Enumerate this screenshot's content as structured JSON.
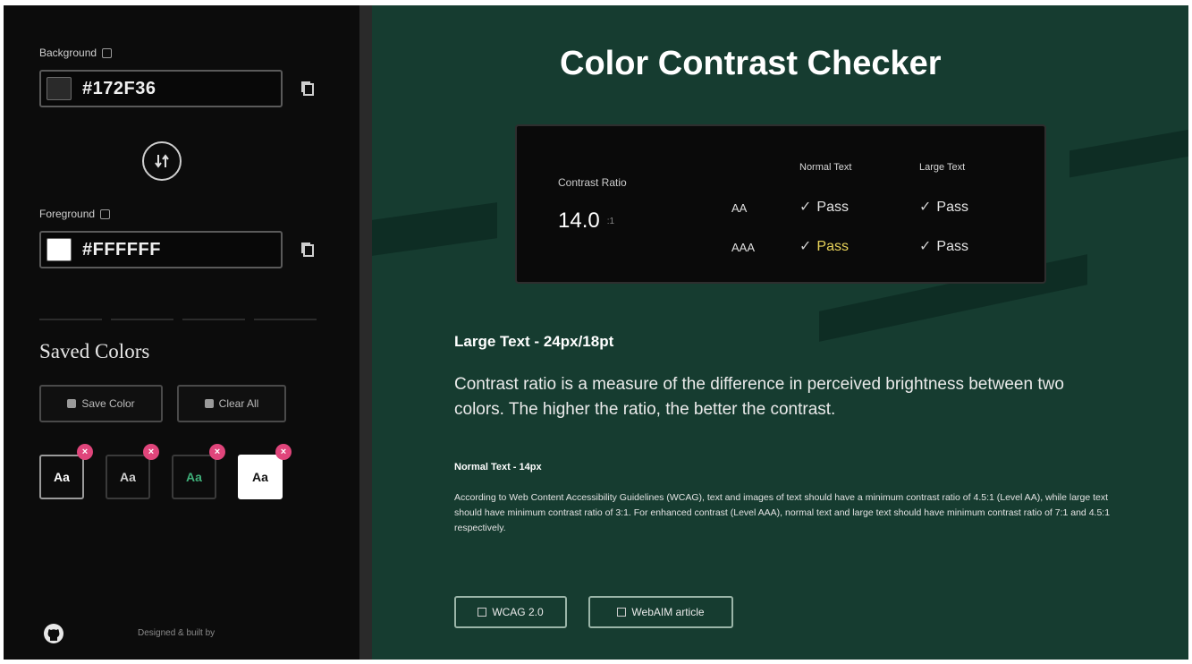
{
  "sidebar": {
    "background": {
      "label": "Background",
      "value": "#172F36",
      "swatch_color": "#2a2a2a"
    },
    "foreground": {
      "label": "Foreground",
      "value": "#FFFFFF",
      "swatch_color": "#ffffff"
    },
    "saved": {
      "title": "Saved Colors",
      "save_label": "Save Color",
      "clear_label": "Clear All",
      "cards": [
        {
          "text": "Aa",
          "bg": "#0c0c0c",
          "fg": "#ffffff",
          "border": "#9a9a9a"
        },
        {
          "text": "Aa",
          "bg": "#0c0c0c",
          "fg": "#cfcfcf",
          "border": "#3a3a3a"
        },
        {
          "text": "Aa",
          "bg": "#0c0c0c",
          "fg": "#3fb07a",
          "border": "#3a3a3a"
        },
        {
          "text": "Aa",
          "bg": "#ffffff",
          "fg": "#111111",
          "border": "#ffffff"
        }
      ],
      "remove_glyph": "×"
    },
    "footer": "Designed & built by"
  },
  "main": {
    "title": "Color Contrast Checker",
    "ratio_label": "Contrast Ratio",
    "ratio_value": "14.0",
    "ratio_unit": ":1",
    "columns": [
      "Normal Text",
      "Large Text"
    ],
    "rows": [
      {
        "level": "AA",
        "normal": "Pass",
        "large": "Pass"
      },
      {
        "level": "AAA",
        "normal": "Pass",
        "large": "Pass"
      }
    ],
    "check_glyph": "✓",
    "large_heading": "Large Text - 24px/18pt",
    "large_body": "Contrast ratio is a measure of the difference in perceived brightness between two colors. The higher the ratio, the better the contrast.",
    "normal_heading": "Normal Text - 14px",
    "normal_body": "According to Web Content Accessibility Guidelines (WCAG), text and images of text should have a minimum contrast ratio of 4.5:1 (Level AA), while large text should have minimum contrast ratio of 3:1. For enhanced contrast (Level AAA), normal text and large text should have minimum contrast ratio of 7:1 and 4.5:1 respectively.",
    "links": [
      "WCAG 2.0",
      "WebAIM article"
    ]
  },
  "colors": {
    "sidebar_bg": "#0c0c0c",
    "main_bg": "#163c30",
    "accent_remove": "#e0457b",
    "highlight_pass": "#e9d45a"
  }
}
